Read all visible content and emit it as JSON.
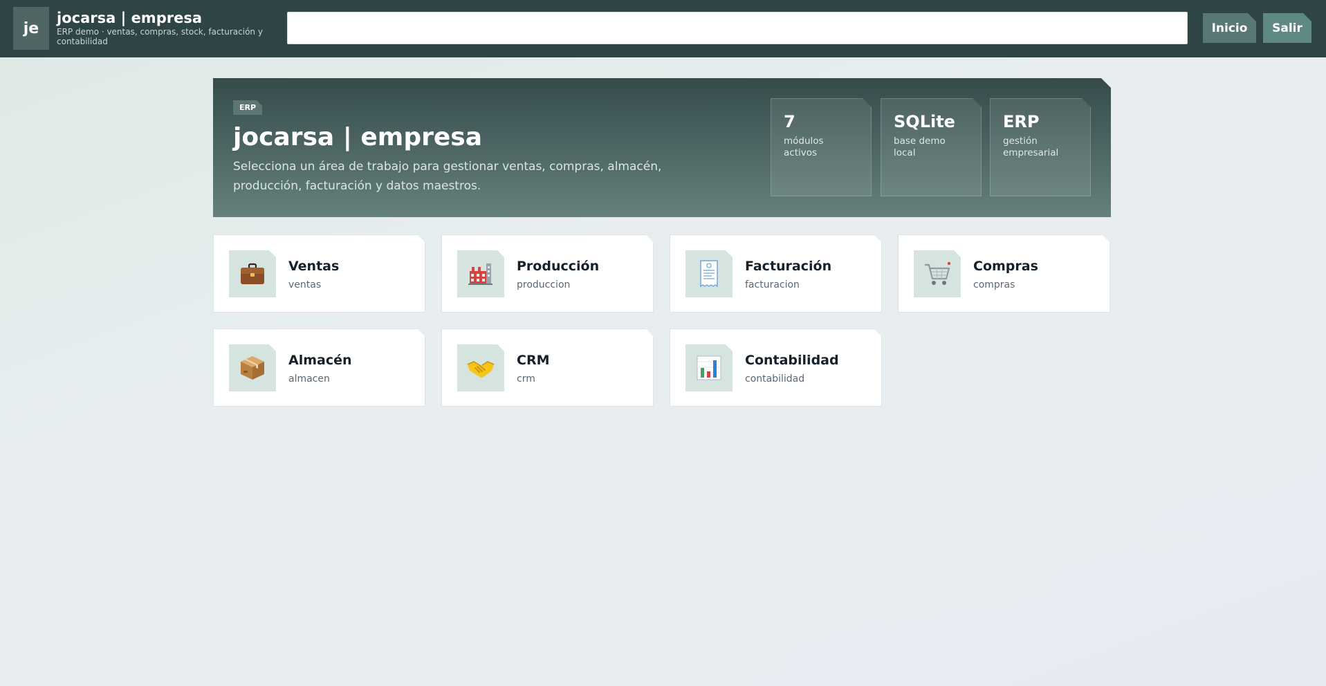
{
  "header": {
    "logo_text": "je",
    "title": "jocarsa | empresa",
    "subtitle": "ERP demo · ventas, compras, stock, facturación y contabilidad",
    "search_value": "",
    "search_placeholder": "",
    "buttons": {
      "inicio": "Inicio",
      "salir": "Salir"
    }
  },
  "hero": {
    "tag": "ERP",
    "title": "jocarsa | empresa",
    "description": "Selecciona un área de trabajo para gestionar ventas, compras, almacén, producción, facturación y datos maestros.",
    "stats": [
      {
        "value": "7",
        "label": "módulos activos"
      },
      {
        "value": "SQLite",
        "label": "base demo local"
      },
      {
        "value": "ERP",
        "label": "gestión empresarial"
      }
    ]
  },
  "modules": [
    {
      "title": "Ventas",
      "slug": "ventas",
      "icon": "briefcase-icon"
    },
    {
      "title": "Producción",
      "slug": "produccion",
      "icon": "factory-icon"
    },
    {
      "title": "Facturación",
      "slug": "facturacion",
      "icon": "receipt-icon"
    },
    {
      "title": "Compras",
      "slug": "compras",
      "icon": "shopping-cart-icon"
    },
    {
      "title": "Almacén",
      "slug": "almacen",
      "icon": "package-icon"
    },
    {
      "title": "CRM",
      "slug": "crm",
      "icon": "handshake-icon"
    },
    {
      "title": "Contabilidad",
      "slug": "contabilidad",
      "icon": "bar-chart-icon"
    }
  ],
  "colors": {
    "topbar": "#2f4444",
    "accent": "#587775",
    "card_icon_bg": "#d6e4e0"
  }
}
